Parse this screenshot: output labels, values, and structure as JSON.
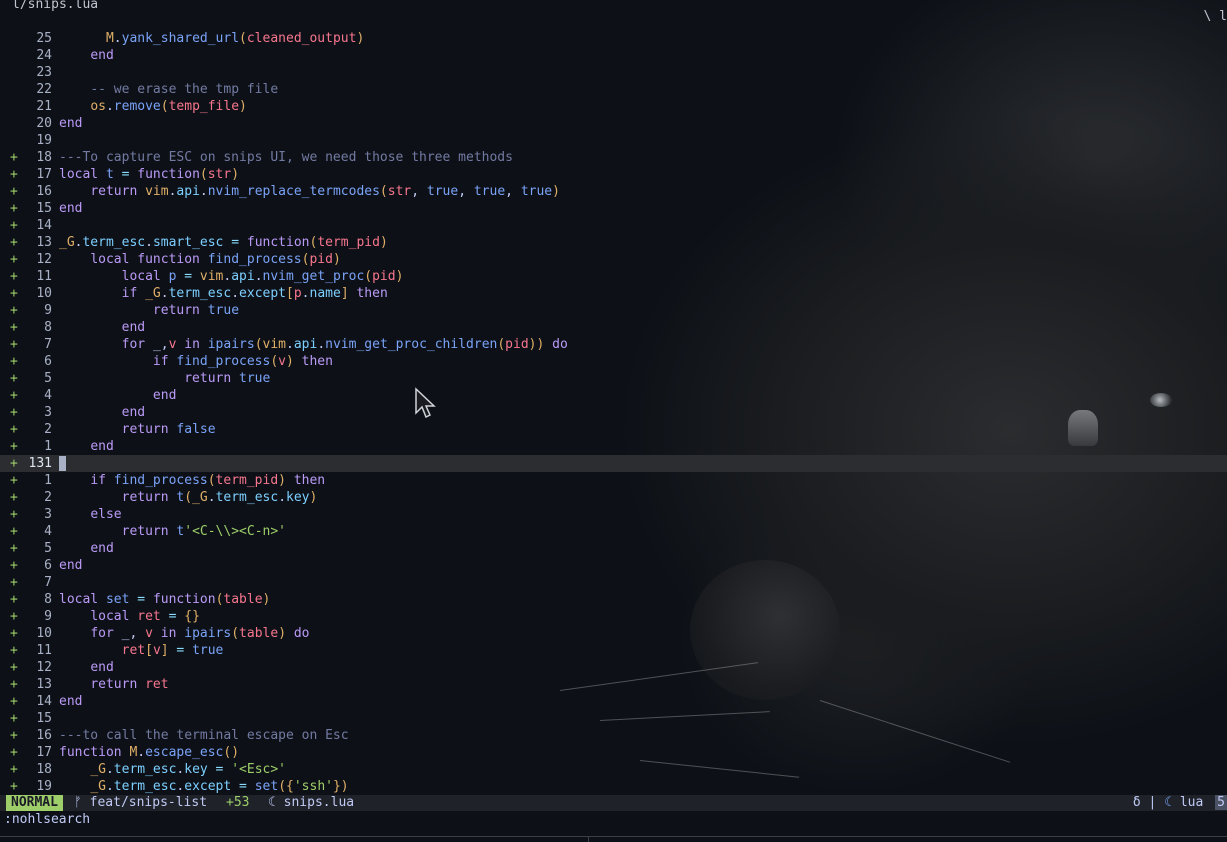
{
  "window": {
    "file_path": "l/snips.lua",
    "right_fragment": "\\ l"
  },
  "lines": [
    {
      "sign": "",
      "num": "25",
      "code": [
        [
          "      ",
          ""
        ],
        [
          "M",
          "mod"
        ],
        [
          ".",
          "id"
        ],
        [
          "yank_shared_url",
          "fn"
        ],
        [
          "(",
          "par"
        ],
        [
          "cleaned_output",
          "prm"
        ],
        [
          ")",
          "par"
        ]
      ]
    },
    {
      "sign": "",
      "num": "24",
      "code": [
        [
          "    ",
          ""
        ],
        [
          "end",
          "end"
        ]
      ]
    },
    {
      "sign": "",
      "num": "23",
      "code": []
    },
    {
      "sign": "",
      "num": "22",
      "code": [
        [
          "    ",
          ""
        ],
        [
          "-- we erase the tmp file",
          "cmt"
        ]
      ]
    },
    {
      "sign": "",
      "num": "21",
      "code": [
        [
          "    ",
          ""
        ],
        [
          "os",
          "mod"
        ],
        [
          ".",
          "id"
        ],
        [
          "remove",
          "fn"
        ],
        [
          "(",
          "par"
        ],
        [
          "temp_file",
          "prm"
        ],
        [
          ")",
          "par"
        ]
      ]
    },
    {
      "sign": "",
      "num": "20",
      "code": [
        [
          "end",
          "end"
        ]
      ]
    },
    {
      "sign": "",
      "num": "19",
      "code": []
    },
    {
      "sign": "+",
      "num": "18",
      "code": [
        [
          "---To capture ESC on snips UI, we need those three methods",
          "cmt"
        ]
      ]
    },
    {
      "sign": "+",
      "num": "17",
      "code": [
        [
          "local ",
          "kw"
        ],
        [
          "t",
          "fn"
        ],
        [
          " = ",
          "op"
        ],
        [
          "function",
          "kw"
        ],
        [
          "(",
          "par"
        ],
        [
          "str",
          "prm"
        ],
        [
          ")",
          "par"
        ]
      ]
    },
    {
      "sign": "+",
      "num": "16",
      "code": [
        [
          "    ",
          ""
        ],
        [
          "return ",
          "kw"
        ],
        [
          "vim",
          "mod"
        ],
        [
          ".",
          "id"
        ],
        [
          "api",
          "fld"
        ],
        [
          ".",
          "id"
        ],
        [
          "nvim_replace_termcodes",
          "fn"
        ],
        [
          "(",
          "par"
        ],
        [
          "str",
          "prm"
        ],
        [
          ", ",
          "id"
        ],
        [
          "true",
          "bool"
        ],
        [
          ", ",
          "id"
        ],
        [
          "true",
          "bool"
        ],
        [
          ", ",
          "id"
        ],
        [
          "true",
          "bool"
        ],
        [
          ")",
          "par"
        ]
      ]
    },
    {
      "sign": "+",
      "num": "15",
      "code": [
        [
          "end",
          "end"
        ]
      ]
    },
    {
      "sign": "+",
      "num": "14",
      "code": []
    },
    {
      "sign": "+",
      "num": "13",
      "code": [
        [
          "_G",
          "mod"
        ],
        [
          ".",
          "id"
        ],
        [
          "term_esc",
          "fld"
        ],
        [
          ".",
          "id"
        ],
        [
          "smart_esc",
          "fld"
        ],
        [
          " = ",
          "op"
        ],
        [
          "function",
          "kw"
        ],
        [
          "(",
          "par"
        ],
        [
          "term_pid",
          "prm"
        ],
        [
          ")",
          "par"
        ]
      ]
    },
    {
      "sign": "+",
      "num": "12",
      "code": [
        [
          "    ",
          ""
        ],
        [
          "local function ",
          "kw"
        ],
        [
          "find_process",
          "fn"
        ],
        [
          "(",
          "par"
        ],
        [
          "pid",
          "prm"
        ],
        [
          ")",
          "par"
        ]
      ]
    },
    {
      "sign": "+",
      "num": "11",
      "code": [
        [
          "        ",
          ""
        ],
        [
          "local ",
          "kw"
        ],
        [
          "p",
          "fn"
        ],
        [
          " = ",
          "op"
        ],
        [
          "vim",
          "mod"
        ],
        [
          ".",
          "id"
        ],
        [
          "api",
          "fld"
        ],
        [
          ".",
          "id"
        ],
        [
          "nvim_get_proc",
          "fn"
        ],
        [
          "(",
          "par"
        ],
        [
          "pid",
          "prm"
        ],
        [
          ")",
          "par"
        ]
      ]
    },
    {
      "sign": "+",
      "num": "10",
      "code": [
        [
          "        ",
          ""
        ],
        [
          "if ",
          "kw"
        ],
        [
          "_G",
          "mod"
        ],
        [
          ".",
          "id"
        ],
        [
          "term_esc",
          "fld"
        ],
        [
          ".",
          "id"
        ],
        [
          "except",
          "fld"
        ],
        [
          "[",
          "par"
        ],
        [
          "p",
          "prm"
        ],
        [
          ".",
          "id"
        ],
        [
          "name",
          "fld"
        ],
        [
          "]",
          "par"
        ],
        [
          " then",
          "kw"
        ]
      ]
    },
    {
      "sign": "+",
      "num": "9",
      "code": [
        [
          "            ",
          ""
        ],
        [
          "return ",
          "kw"
        ],
        [
          "true",
          "bool"
        ]
      ]
    },
    {
      "sign": "+",
      "num": "8",
      "code": [
        [
          "        ",
          ""
        ],
        [
          "end",
          "end"
        ]
      ]
    },
    {
      "sign": "+",
      "num": "7",
      "code": [
        [
          "        ",
          ""
        ],
        [
          "for ",
          "kw"
        ],
        [
          "_",
          "id"
        ],
        [
          ",",
          "id"
        ],
        [
          "v ",
          "prm"
        ],
        [
          "in ",
          "kw"
        ],
        [
          "ipairs",
          "fn"
        ],
        [
          "(",
          "par"
        ],
        [
          "vim",
          "mod"
        ],
        [
          ".",
          "id"
        ],
        [
          "api",
          "fld"
        ],
        [
          ".",
          "id"
        ],
        [
          "nvim_get_proc_children",
          "fn"
        ],
        [
          "(",
          "par"
        ],
        [
          "pid",
          "prm"
        ],
        [
          "))",
          "par"
        ],
        [
          " do",
          "kw"
        ]
      ]
    },
    {
      "sign": "+",
      "num": "6",
      "code": [
        [
          "            ",
          ""
        ],
        [
          "if ",
          "kw"
        ],
        [
          "find_process",
          "fn"
        ],
        [
          "(",
          "par"
        ],
        [
          "v",
          "prm"
        ],
        [
          ")",
          "par"
        ],
        [
          " then",
          "kw"
        ]
      ]
    },
    {
      "sign": "+",
      "num": "5",
      "code": [
        [
          "                ",
          ""
        ],
        [
          "return ",
          "kw"
        ],
        [
          "true",
          "bool"
        ]
      ]
    },
    {
      "sign": "+",
      "num": "4",
      "code": [
        [
          "            ",
          ""
        ],
        [
          "end",
          "end"
        ]
      ]
    },
    {
      "sign": "+",
      "num": "3",
      "code": [
        [
          "        ",
          ""
        ],
        [
          "end",
          "end"
        ]
      ]
    },
    {
      "sign": "+",
      "num": "2",
      "code": [
        [
          "        ",
          ""
        ],
        [
          "return ",
          "kw"
        ],
        [
          "false",
          "bool"
        ]
      ]
    },
    {
      "sign": "+",
      "num": "1",
      "code": [
        [
          "    ",
          ""
        ],
        [
          "end",
          "end"
        ]
      ]
    },
    {
      "sign": "+",
      "num": "131",
      "code": [],
      "current": true
    },
    {
      "sign": "+",
      "num": "1",
      "code": [
        [
          "    ",
          ""
        ],
        [
          "if ",
          "kw"
        ],
        [
          "find_process",
          "fn"
        ],
        [
          "(",
          "par"
        ],
        [
          "term_pid",
          "prm"
        ],
        [
          ")",
          "par"
        ],
        [
          " then",
          "kw"
        ]
      ]
    },
    {
      "sign": "+",
      "num": "2",
      "code": [
        [
          "        ",
          ""
        ],
        [
          "return ",
          "kw"
        ],
        [
          "t",
          "fn"
        ],
        [
          "(",
          "par"
        ],
        [
          "_G",
          "mod"
        ],
        [
          ".",
          "id"
        ],
        [
          "term_esc",
          "fld"
        ],
        [
          ".",
          "id"
        ],
        [
          "key",
          "fld"
        ],
        [
          ")",
          "par"
        ]
      ]
    },
    {
      "sign": "+",
      "num": "3",
      "code": [
        [
          "    ",
          ""
        ],
        [
          "else",
          "kw"
        ]
      ]
    },
    {
      "sign": "+",
      "num": "4",
      "code": [
        [
          "        ",
          ""
        ],
        [
          "return ",
          "kw"
        ],
        [
          "t",
          "fn"
        ],
        [
          "'<C-\\\\><C-n>'",
          "str"
        ]
      ]
    },
    {
      "sign": "+",
      "num": "5",
      "code": [
        [
          "    ",
          ""
        ],
        [
          "end",
          "end"
        ]
      ]
    },
    {
      "sign": "+",
      "num": "6",
      "code": [
        [
          "end",
          "end"
        ]
      ]
    },
    {
      "sign": "+",
      "num": "7",
      "code": []
    },
    {
      "sign": "+",
      "num": "8",
      "code": [
        [
          "local ",
          "kw"
        ],
        [
          "set",
          "fn"
        ],
        [
          " = ",
          "op"
        ],
        [
          "function",
          "kw"
        ],
        [
          "(",
          "par"
        ],
        [
          "table",
          "prm"
        ],
        [
          ")",
          "par"
        ]
      ]
    },
    {
      "sign": "+",
      "num": "9",
      "code": [
        [
          "    ",
          ""
        ],
        [
          "local ",
          "kw"
        ],
        [
          "ret",
          "prm"
        ],
        [
          " = ",
          "op"
        ],
        [
          "{}",
          "par"
        ]
      ]
    },
    {
      "sign": "+",
      "num": "10",
      "code": [
        [
          "    ",
          ""
        ],
        [
          "for ",
          "kw"
        ],
        [
          "_",
          "id"
        ],
        [
          ", ",
          "id"
        ],
        [
          "v ",
          "prm"
        ],
        [
          "in ",
          "kw"
        ],
        [
          "ipairs",
          "fn"
        ],
        [
          "(",
          "par"
        ],
        [
          "table",
          "prm"
        ],
        [
          ")",
          "par"
        ],
        [
          " do",
          "kw"
        ]
      ]
    },
    {
      "sign": "+",
      "num": "11",
      "code": [
        [
          "        ",
          ""
        ],
        [
          "ret",
          "prm"
        ],
        [
          "[",
          "par"
        ],
        [
          "v",
          "prm"
        ],
        [
          "]",
          "par"
        ],
        [
          " = ",
          "op"
        ],
        [
          "true",
          "bool"
        ]
      ]
    },
    {
      "sign": "+",
      "num": "12",
      "code": [
        [
          "    ",
          ""
        ],
        [
          "end",
          "end"
        ]
      ]
    },
    {
      "sign": "+",
      "num": "13",
      "code": [
        [
          "    ",
          ""
        ],
        [
          "return ",
          "kw"
        ],
        [
          "ret",
          "prm"
        ]
      ]
    },
    {
      "sign": "+",
      "num": "14",
      "code": [
        [
          "end",
          "end"
        ]
      ]
    },
    {
      "sign": "+",
      "num": "15",
      "code": []
    },
    {
      "sign": "+",
      "num": "16",
      "code": [
        [
          "---to call the terminal escape on Esc",
          "cmt"
        ]
      ]
    },
    {
      "sign": "+",
      "num": "17",
      "code": [
        [
          "function ",
          "kw"
        ],
        [
          "M",
          "mod"
        ],
        [
          ".",
          "id"
        ],
        [
          "escape_esc",
          "fn"
        ],
        [
          "()",
          "par"
        ]
      ]
    },
    {
      "sign": "+",
      "num": "18",
      "code": [
        [
          "    ",
          ""
        ],
        [
          "_G",
          "mod"
        ],
        [
          ".",
          "id"
        ],
        [
          "term_esc",
          "fld"
        ],
        [
          ".",
          "id"
        ],
        [
          "key",
          "fld"
        ],
        [
          " = ",
          "op"
        ],
        [
          "'<Esc>'",
          "str"
        ]
      ]
    },
    {
      "sign": "+",
      "num": "19",
      "code": [
        [
          "    ",
          ""
        ],
        [
          "_G",
          "mod"
        ],
        [
          ".",
          "id"
        ],
        [
          "term_esc",
          "fld"
        ],
        [
          ".",
          "id"
        ],
        [
          "except",
          "fld"
        ],
        [
          " = ",
          "op"
        ],
        [
          "set",
          "fn"
        ],
        [
          "({",
          "par"
        ],
        [
          "'ssh'",
          "str"
        ],
        [
          "})",
          "par"
        ]
      ]
    }
  ],
  "statusline": {
    "mode": "NORMAL",
    "branch_icon": "git-branch-icon",
    "branch": "feat/snips-list",
    "added": "+53",
    "file_icon": "lua-icon",
    "filename": "snips.lua",
    "right_icon": "δ",
    "separator": "|",
    "filetype": "lua",
    "position": "5"
  },
  "cmdline": ":nohlsearch",
  "colors": {
    "background": "#0d1117",
    "mode_bg": "#9ece6a",
    "added": "#9ece6a",
    "current_line": "#2b2d31"
  }
}
